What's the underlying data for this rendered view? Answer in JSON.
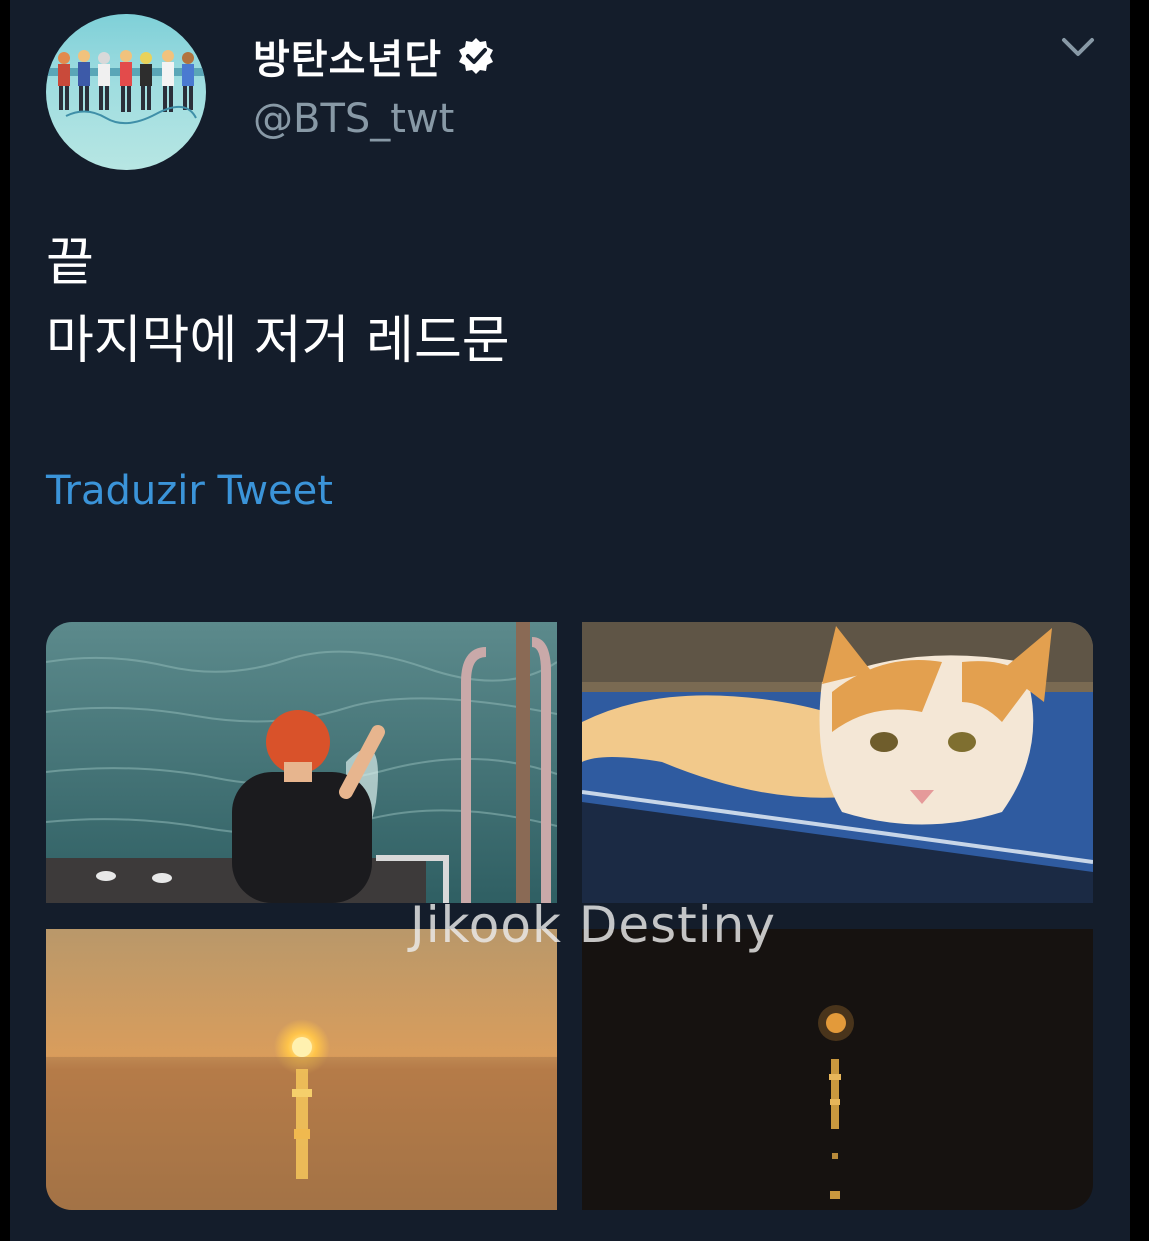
{
  "tweet": {
    "display_name": "방탄소년단",
    "handle": "@BTS_twt",
    "text_lines": [
      "끝",
      "마지막에 저거 레드문"
    ],
    "translate_label": "Traduzir Tweet",
    "verified_icon": "verified-badge-icon",
    "menu_icon": "chevron-down-icon"
  },
  "media": {
    "photos": [
      "boat-sea-photo",
      "cat-photo",
      "sunset-photo",
      "red-moon-photo"
    ]
  },
  "watermark": "Jikook Destiny",
  "colors": {
    "background": "#141d2b",
    "link": "#3b94d9",
    "secondary_text": "#8899a6"
  }
}
